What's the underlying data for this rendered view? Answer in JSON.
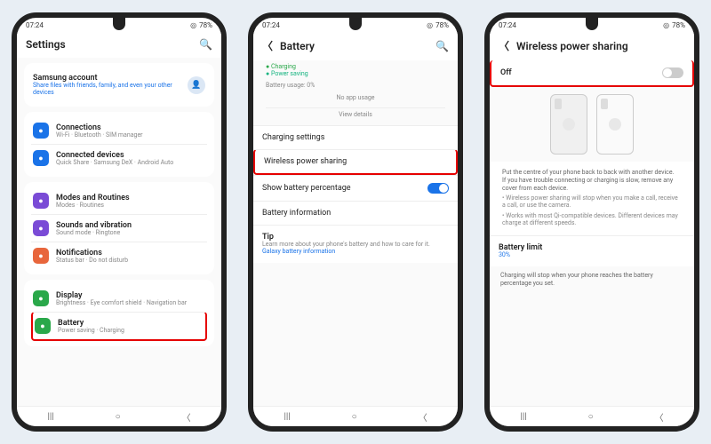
{
  "status": {
    "time": "07:24",
    "battery": "78%"
  },
  "s1": {
    "title": "Settings",
    "acct": {
      "t": "Samsung account",
      "s": "Share files with friends, family, and even your other devices"
    },
    "items": [
      {
        "c": "#1a73e8",
        "t": "Connections",
        "s": "Wi-Fi · Bluetooth · SIM manager"
      },
      {
        "c": "#1a73e8",
        "t": "Connected devices",
        "s": "Quick Share · Samsung DeX · Android Auto"
      }
    ],
    "items2": [
      {
        "c": "#7a4bd6",
        "t": "Modes and Routines",
        "s": "Modes · Routines"
      },
      {
        "c": "#7a4bd6",
        "t": "Sounds and vibration",
        "s": "Sound mode · Ringtone"
      },
      {
        "c": "#e8663c",
        "t": "Notifications",
        "s": "Status bar · Do not disturb"
      }
    ],
    "items3": [
      {
        "c": "#2aa84a",
        "t": "Display",
        "s": "Brightness · Eye comfort shield · Navigation bar"
      },
      {
        "c": "#2aa84a",
        "t": "Battery",
        "s": "Power saving · Charging",
        "hl": true
      }
    ]
  },
  "s2": {
    "title": "Battery",
    "leg": [
      "Charging",
      "Power saving"
    ],
    "usage": "Battery usage: 0%",
    "noapp": "No app usage",
    "view": "View details",
    "rows": [
      {
        "t": "Charging settings"
      },
      {
        "t": "Wireless power sharing",
        "hl": true
      },
      {
        "t": "Show battery percentage",
        "tog": "on"
      },
      {
        "t": "Battery information"
      }
    ],
    "tip": {
      "h": "Tip",
      "b": "Learn more about your phone's battery and how to care for it.",
      "l": "Galaxy battery information"
    }
  },
  "s3": {
    "title": "Wireless power sharing",
    "off": "Off",
    "desc1": "Put the centre of your phone back to back with another device.",
    "desc2": "If you have trouble connecting or charging is slow, remove any cover from each device.",
    "b1": "Wireless power sharing will stop when you make a call, receive a call, or use the camera.",
    "b2": "Works with most Qi-compatible devices. Different devices may charge at different speeds.",
    "lim": {
      "t": "Battery limit",
      "v": "30%"
    },
    "foot": "Charging will stop when your phone reaches the battery percentage you set."
  }
}
